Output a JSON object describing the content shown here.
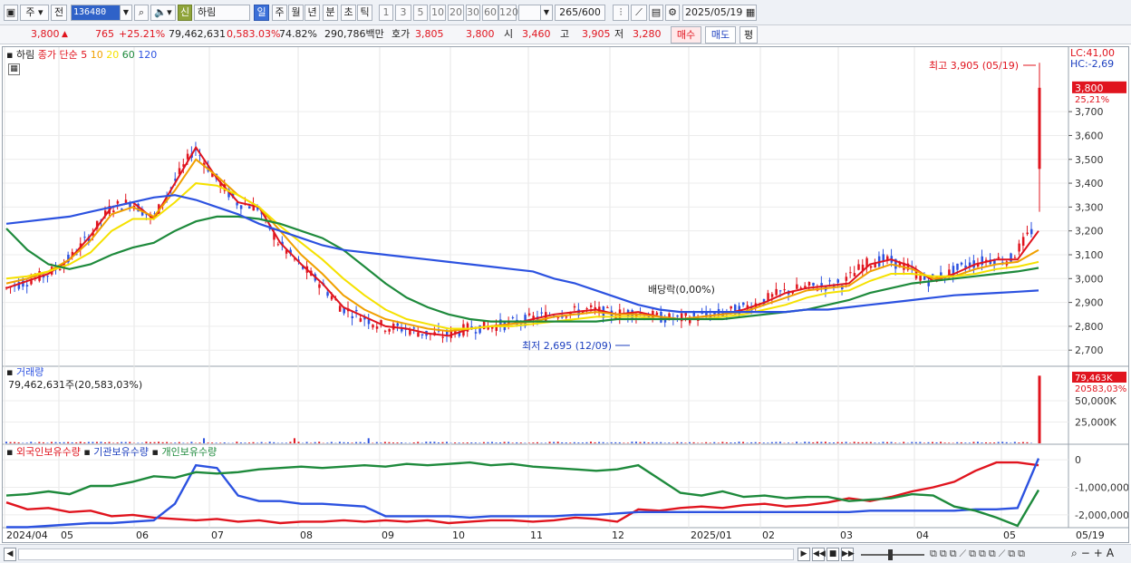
{
  "toolbar": {
    "period_btn": "주",
    "prev_btn": "전",
    "code": "136480",
    "new_btn": "신",
    "stock_name": "하림",
    "periods": [
      "일",
      "주",
      "월",
      "년",
      "분",
      "초",
      "틱"
    ],
    "nums": [
      "1",
      "3",
      "5",
      "10",
      "20",
      "30",
      "60",
      "120"
    ],
    "count": "265",
    "count_max": "/600",
    "date": "2025/05/19"
  },
  "quote": {
    "price": "3,800",
    "change": "765",
    "change_pct": "+25.21%",
    "volume": "79,462,631",
    "vol_ratio": "0,583.03%",
    "turnover": "74.82%",
    "amount": "290,786백만",
    "ask_label": "호가",
    "ask": "3,805",
    "bid": "3,800",
    "open_label": "시",
    "open": "3,460",
    "high_label": "고",
    "high": "3,905",
    "low_label": "저",
    "low": "3,280",
    "buy_btn": "매수",
    "sell_btn": "매도",
    "eval_btn": "평"
  },
  "legend": {
    "name": "하림",
    "ma_title": "종가 단순",
    "ma_periods": [
      "5",
      "10",
      "20",
      "60",
      "120"
    ],
    "ma_colors": [
      "#e0141e",
      "#f0a000",
      "#f5e100",
      "#1e8a3c",
      "#2c52e0"
    ],
    "lc": "LC:41,00",
    "hc": "HC:-2,69",
    "max_note": "최고 3,905 (05/19)",
    "min_note": "최저 2,695 (12/09)",
    "dividend": "배당락(0,00%)",
    "last_price": "3,800",
    "last_pct": "25,21%"
  },
  "volume_panel": {
    "title": "거래량",
    "value": "79,462,631주(20,583,03%)",
    "last": "79,463K",
    "last_pct": "20583,03%",
    "ticks": [
      "50,000K",
      "25,000K"
    ]
  },
  "holdings_panel": {
    "titles": [
      "외국인보유수량",
      "기관보유수량",
      "개인보유수량"
    ],
    "colors": [
      "#e0141e",
      "#2c52e0",
      "#1e8a3c"
    ],
    "ticks": [
      "0",
      "-1,000,000",
      "-2,000,000"
    ]
  },
  "x_axis": [
    "2024/04",
    "05",
    "06",
    "07",
    "08",
    "09",
    "10",
    "11",
    "12",
    "2025/01",
    "02",
    "03",
    "04",
    "05",
    "05/19"
  ],
  "chart_data": {
    "type": "line",
    "title": "",
    "price_ticks": [
      3700,
      3600,
      3500,
      3400,
      3300,
      3200,
      3100,
      3000,
      2900,
      2800,
      2700
    ],
    "ylim": [
      2640,
      3940
    ],
    "ma5": [
      2960,
      2990,
      3020,
      3080,
      3180,
      3300,
      3320,
      3250,
      3400,
      3550,
      3420,
      3320,
      3300,
      3150,
      3060,
      2980,
      2880,
      2840,
      2800,
      2790,
      2770,
      2760,
      2790,
      2800,
      2810,
      2830,
      2850,
      2860,
      2870,
      2850,
      2860,
      2840,
      2830,
      2840,
      2850,
      2870,
      2900,
      2940,
      2960,
      2970,
      2980,
      3060,
      3080,
      3050,
      2990,
      3020,
      3060,
      3080,
      3080,
      3200
    ],
    "ma10": [
      2980,
      3000,
      3030,
      3080,
      3160,
      3270,
      3300,
      3260,
      3370,
      3500,
      3430,
      3350,
      3300,
      3200,
      3100,
      3020,
      2930,
      2870,
      2830,
      2810,
      2790,
      2780,
      2790,
      2800,
      2810,
      2820,
      2840,
      2850,
      2860,
      2850,
      2850,
      2840,
      2830,
      2840,
      2850,
      2860,
      2890,
      2920,
      2950,
      2960,
      2970,
      3030,
      3060,
      3040,
      3000,
      3010,
      3040,
      3060,
      3070,
      3120
    ],
    "ma20": [
      3000,
      3010,
      3030,
      3060,
      3110,
      3200,
      3250,
      3250,
      3320,
      3400,
      3390,
      3350,
      3300,
      3220,
      3150,
      3080,
      3000,
      2930,
      2870,
      2830,
      2810,
      2790,
      2790,
      2800,
      2800,
      2810,
      2820,
      2830,
      2840,
      2840,
      2840,
      2830,
      2830,
      2830,
      2840,
      2850,
      2870,
      2890,
      2920,
      2940,
      2950,
      2990,
      3020,
      3020,
      3010,
      3010,
      3020,
      3040,
      3050,
      3070
    ],
    "ma60": [
      3210,
      3120,
      3060,
      3040,
      3060,
      3100,
      3130,
      3150,
      3200,
      3240,
      3260,
      3260,
      3250,
      3230,
      3200,
      3170,
      3120,
      3050,
      2980,
      2920,
      2880,
      2850,
      2830,
      2820,
      2820,
      2820,
      2820,
      2820,
      2820,
      2830,
      2830,
      2830,
      2830,
      2830,
      2830,
      2840,
      2850,
      2860,
      2870,
      2890,
      2910,
      2940,
      2960,
      2980,
      2990,
      3000,
      3010,
      3020,
      3030,
      3045
    ],
    "ma120": [
      3230,
      3240,
      3250,
      3260,
      3280,
      3300,
      3320,
      3340,
      3350,
      3330,
      3300,
      3270,
      3230,
      3200,
      3170,
      3140,
      3120,
      3110,
      3100,
      3090,
      3080,
      3070,
      3060,
      3050,
      3040,
      3030,
      3000,
      2980,
      2950,
      2920,
      2890,
      2870,
      2860,
      2860,
      2860,
      2860,
      2860,
      2860,
      2870,
      2870,
      2880,
      2890,
      2900,
      2910,
      2920,
      2930,
      2935,
      2940,
      2945,
      2950
    ],
    "volume_ticks": [
      50000,
      25000
    ],
    "volume_last_k": 79463
  }
}
